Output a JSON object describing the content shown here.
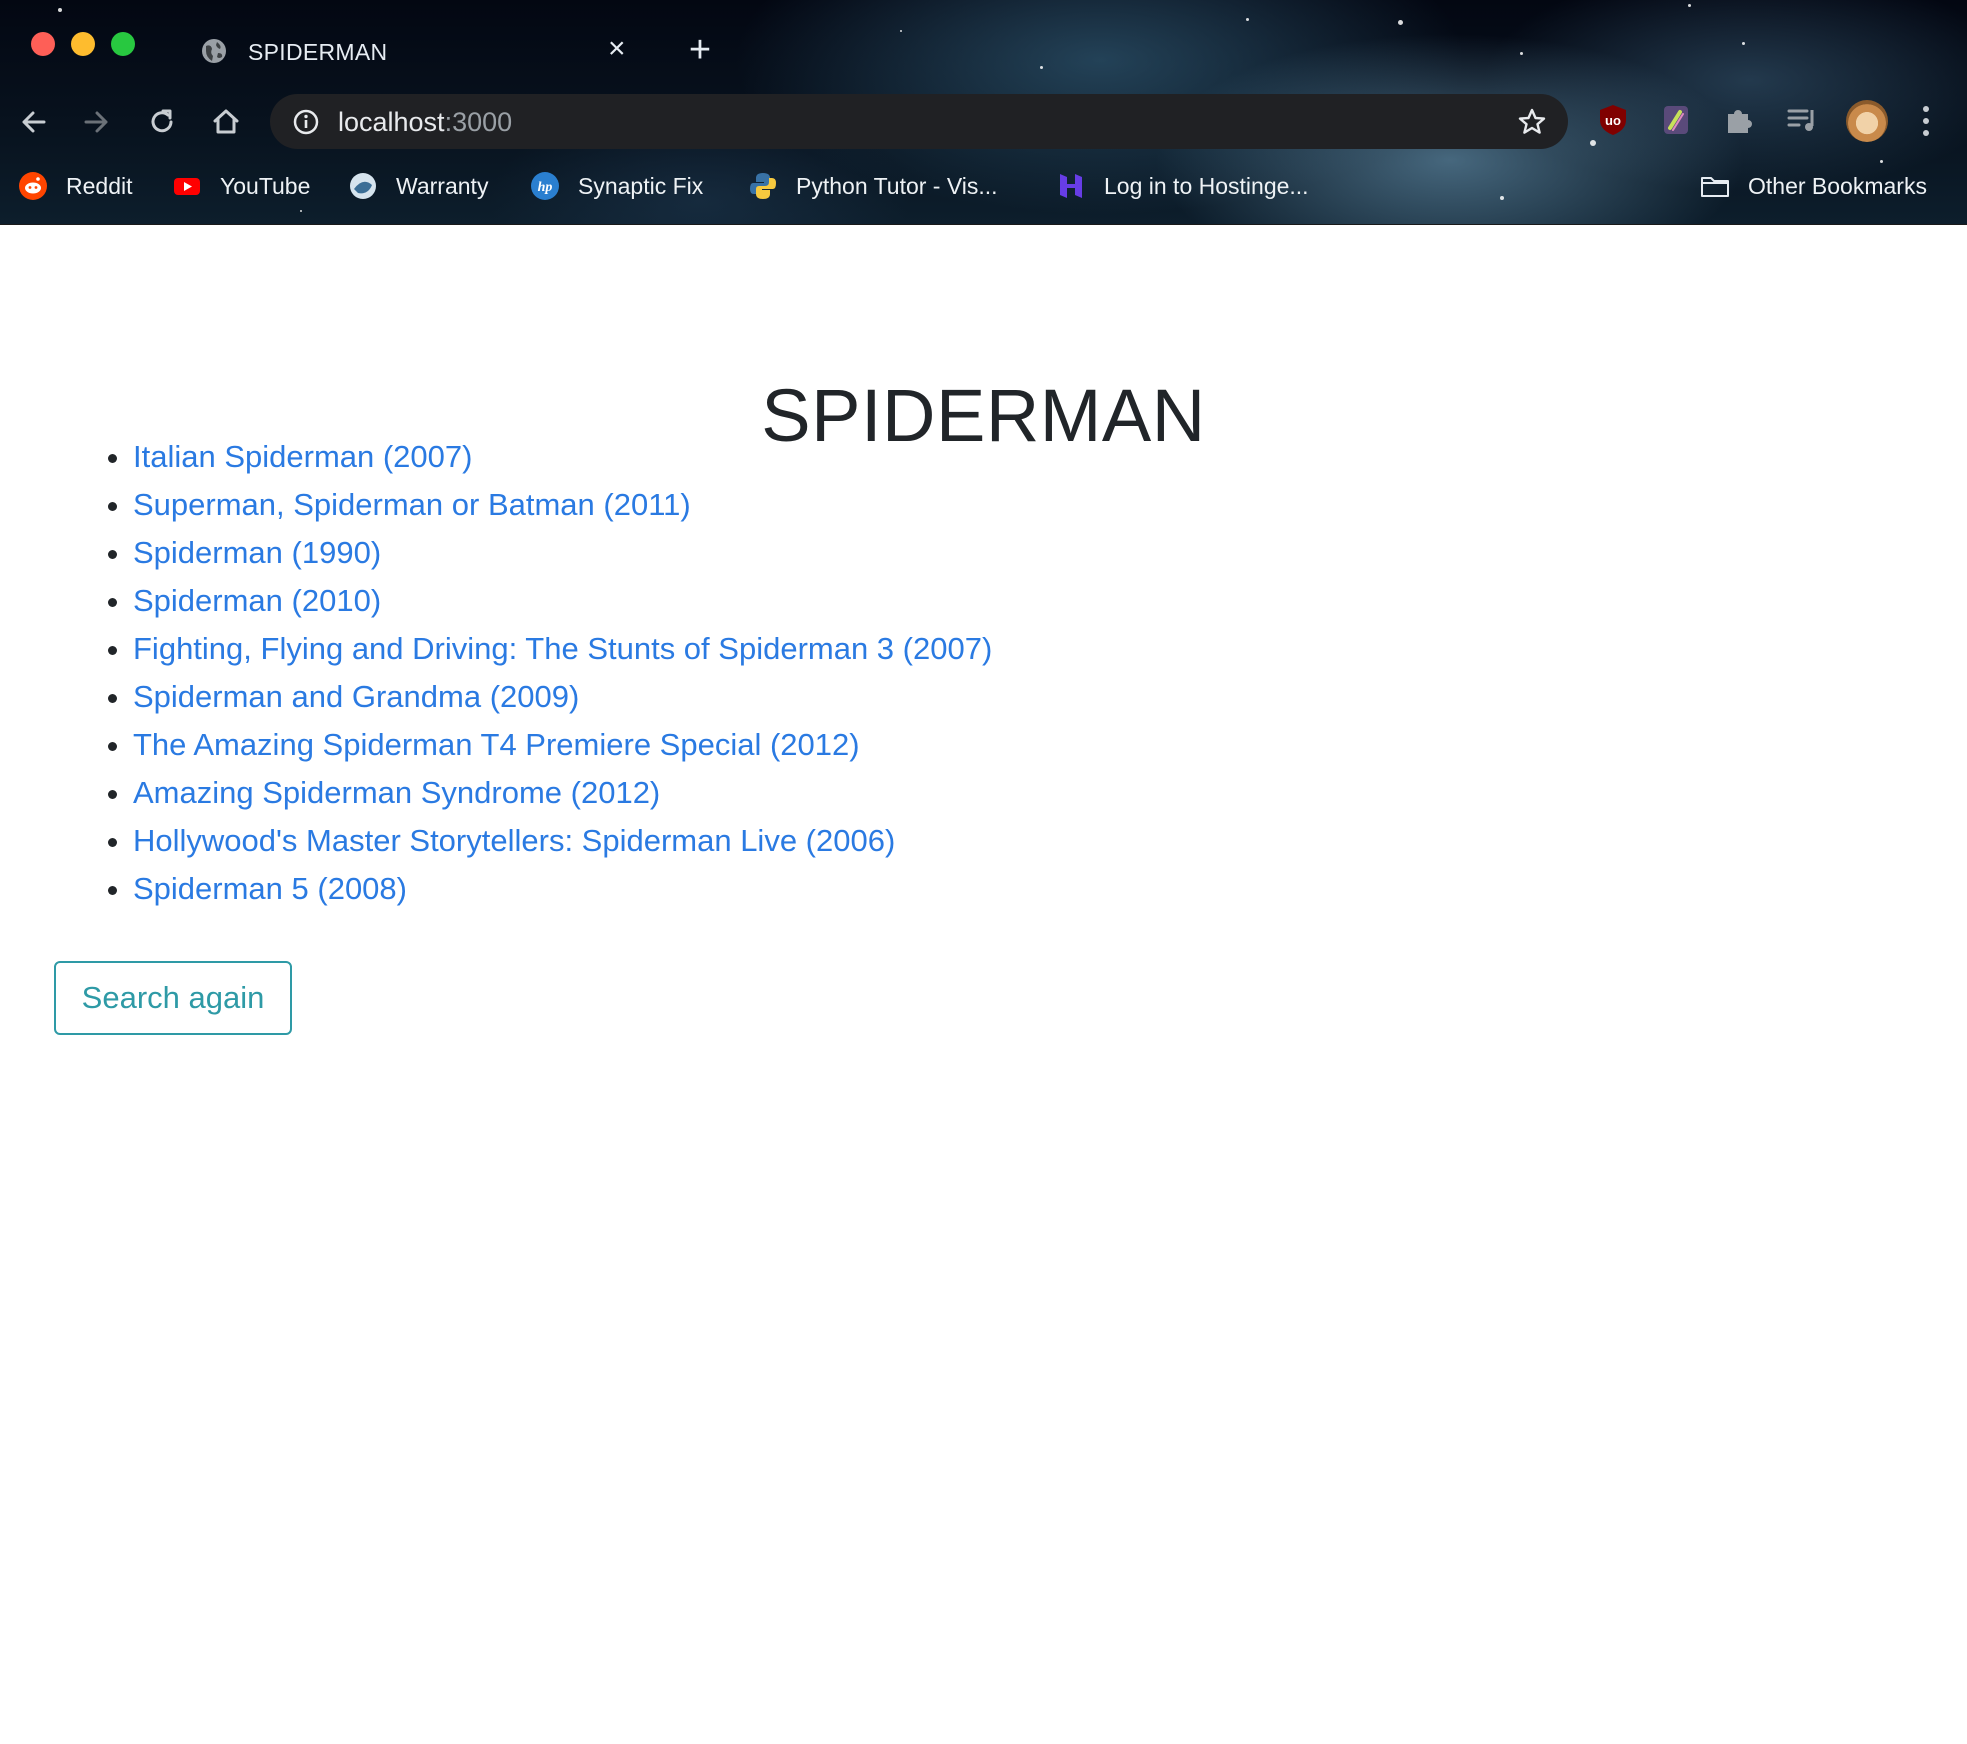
{
  "browser": {
    "tab": {
      "title": "SPIDERMAN",
      "close_label": "×",
      "new_tab_label": "+"
    },
    "address": {
      "host": "localhost",
      "port": ":3000"
    },
    "bookmarks": [
      {
        "label": "Reddit",
        "icon": "reddit-icon"
      },
      {
        "label": "YouTube",
        "icon": "youtube-icon"
      },
      {
        "label": "Warranty",
        "icon": "warranty-icon"
      },
      {
        "label": "Synaptic Fix",
        "icon": "hp-icon"
      },
      {
        "label": "Python Tutor - Vis...",
        "icon": "python-icon"
      },
      {
        "label": "Log in to Hostinge...",
        "icon": "hostinger-icon"
      }
    ],
    "other_bookmarks": "Other Bookmarks"
  },
  "page": {
    "title": "SPIDERMAN",
    "results": [
      "Italian Spiderman (2007)",
      "Superman, Spiderman or Batman (2011)",
      "Spiderman (1990)",
      "Spiderman (2010)",
      "Fighting, Flying and Driving: The Stunts of Spiderman 3 (2007)",
      "Spiderman and Grandma (2009)",
      "The Amazing Spiderman T4 Premiere Special (2012)",
      "Amazing Spiderman Syndrome (2012)",
      "Hollywood's Master Storytellers: Spiderman Live (2006)",
      "Spiderman 5 (2008)"
    ],
    "search_again_label": "Search again"
  },
  "colors": {
    "link": "#2a7ae2",
    "button_outline": "#2e9aa6",
    "text": "#212529"
  }
}
